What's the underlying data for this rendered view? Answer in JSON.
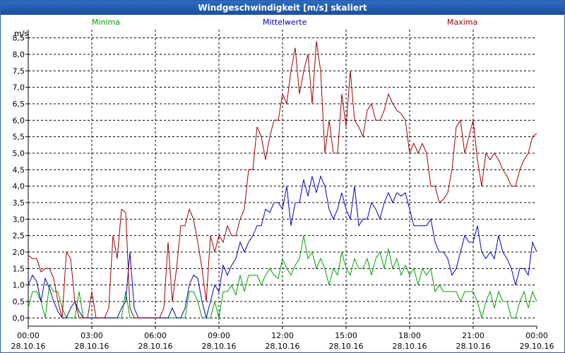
{
  "window": {
    "title": "Windgeschwindigkeit [m/s] skaliert"
  },
  "chart_data": {
    "type": "line",
    "title": "Windgeschwindigkeit [m/s] skaliert",
    "ylabel": "m/s",
    "xlabel": "",
    "ylim": [
      -0.25,
      8.75
    ],
    "xlim": [
      0,
      24
    ],
    "grid": true,
    "yticks": [
      "0,0",
      "0,5",
      "1,0",
      "1,5",
      "2,0",
      "2,5",
      "3,0",
      "3,5",
      "4,0",
      "4,5",
      "5,0",
      "5,5",
      "6,0",
      "6,5",
      "7,0",
      "7,5",
      "8,0",
      "8,5"
    ],
    "xticks": [
      {
        "time": "00:00",
        "date": "28.10.16"
      },
      {
        "time": "03:00",
        "date": "28.10.16"
      },
      {
        "time": "06:00",
        "date": "28.10.16"
      },
      {
        "time": "09:00",
        "date": "28.10.16"
      },
      {
        "time": "12:00",
        "date": "28.10.16"
      },
      {
        "time": "15:00",
        "date": "28.10.16"
      },
      {
        "time": "18:00",
        "date": "28.10.16"
      },
      {
        "time": "21:00",
        "date": "28.10.16"
      },
      {
        "time": "00:00",
        "date": "29.10.16"
      }
    ],
    "legend": [
      "Minima",
      "Mittelwerte",
      "Maxima"
    ],
    "series": [
      {
        "name": "Minima",
        "color": "#00a000",
        "x": [
          0,
          0.2,
          0.4,
          0.6,
          0.8,
          1.0,
          1.2,
          1.4,
          1.6,
          1.8,
          2.0,
          2.2,
          2.4,
          2.6,
          2.8,
          3.0,
          3.2,
          3.4,
          3.6,
          3.8,
          4.0,
          4.2,
          4.4,
          4.6,
          4.8,
          5.0,
          5.2,
          5.4,
          5.6,
          5.8,
          6.0,
          6.2,
          6.4,
          6.6,
          6.8,
          7.0,
          7.2,
          7.4,
          7.6,
          7.8,
          8.0,
          8.2,
          8.4,
          8.6,
          8.8,
          9.0,
          9.2,
          9.4,
          9.6,
          9.8,
          10.0,
          10.2,
          10.4,
          10.6,
          10.8,
          11.0,
          11.2,
          11.4,
          11.6,
          11.8,
          12.0,
          12.2,
          12.4,
          12.6,
          12.8,
          13.0,
          13.2,
          13.4,
          13.6,
          13.8,
          14.0,
          14.2,
          14.4,
          14.6,
          14.8,
          15.0,
          15.2,
          15.4,
          15.6,
          15.8,
          16.0,
          16.2,
          16.4,
          16.6,
          16.8,
          17.0,
          17.2,
          17.4,
          17.6,
          17.8,
          18.0,
          18.2,
          18.4,
          18.6,
          18.8,
          19.0,
          19.2,
          19.4,
          19.6,
          19.8,
          20.0,
          20.2,
          20.4,
          20.6,
          20.8,
          21.0,
          21.2,
          21.4,
          21.6,
          21.8,
          22.0,
          22.2,
          22.4,
          22.6,
          22.8,
          23.0,
          23.2,
          23.4,
          23.6,
          23.8,
          24.0
        ],
        "y": [
          0.3,
          0.8,
          0.8,
          0.5,
          0.0,
          1.0,
          0.8,
          0.8,
          0.3,
          0.0,
          0.0,
          0.0,
          0.8,
          0.0,
          0.0,
          0.0,
          0.0,
          0.0,
          0.0,
          0.0,
          0.0,
          0.0,
          0.0,
          0.8,
          0.0,
          0.0,
          0.0,
          0.0,
          0.0,
          0.0,
          0.0,
          0.0,
          0.0,
          0.0,
          0.0,
          0.0,
          0.0,
          0.0,
          0.8,
          0.8,
          0.5,
          0.0,
          0.0,
          0.0,
          0.5,
          0.0,
          0.8,
          0.8,
          1.0,
          0.7,
          1.3,
          0.8,
          1.3,
          1.3,
          1.3,
          1.0,
          1.3,
          1.5,
          1.3,
          1.2,
          1.8,
          1.5,
          1.3,
          1.6,
          1.8,
          2.5,
          1.8,
          2.0,
          1.5,
          1.8,
          1.5,
          1.0,
          1.5,
          1.3,
          2.0,
          1.5,
          1.3,
          1.8,
          1.5,
          1.5,
          1.8,
          1.3,
          1.8,
          2.0,
          1.5,
          2.1,
          1.5,
          1.8,
          1.3,
          1.6,
          1.3,
          1.5,
          1.0,
          1.5,
          1.3,
          1.5,
          0.8,
          1.0,
          0.8,
          0.8,
          0.8,
          0.8,
          0.5,
          0.8,
          0.8,
          0.8,
          0.5,
          0.0,
          0.5,
          0.8,
          0.3,
          0.8,
          0.5,
          0.5,
          0.0,
          0.0,
          0.5,
          0.8,
          0.3,
          0.8,
          0.5
        ]
      },
      {
        "name": "Mittelwerte",
        "color": "#0000c0",
        "x": [
          0,
          0.2,
          0.4,
          0.6,
          0.8,
          1.0,
          1.2,
          1.4,
          1.6,
          1.8,
          2.0,
          2.2,
          2.4,
          2.6,
          2.8,
          3.0,
          3.2,
          3.4,
          3.6,
          3.8,
          4.0,
          4.2,
          4.4,
          4.6,
          4.8,
          5.0,
          5.2,
          5.4,
          5.6,
          5.8,
          6.0,
          6.2,
          6.4,
          6.6,
          6.8,
          7.0,
          7.2,
          7.4,
          7.6,
          7.8,
          8.0,
          8.2,
          8.4,
          8.6,
          8.8,
          9.0,
          9.2,
          9.4,
          9.6,
          9.8,
          10.0,
          10.2,
          10.4,
          10.6,
          10.8,
          11.0,
          11.2,
          11.4,
          11.6,
          11.8,
          12.0,
          12.2,
          12.4,
          12.6,
          12.8,
          13.0,
          13.2,
          13.4,
          13.6,
          13.8,
          14.0,
          14.2,
          14.4,
          14.6,
          14.8,
          15.0,
          15.2,
          15.4,
          15.6,
          15.8,
          16.0,
          16.2,
          16.4,
          16.6,
          16.8,
          17.0,
          17.2,
          17.4,
          17.6,
          17.8,
          18.0,
          18.2,
          18.4,
          18.6,
          18.8,
          19.0,
          19.2,
          19.4,
          19.6,
          19.8,
          20.0,
          20.2,
          20.4,
          20.6,
          20.8,
          21.0,
          21.2,
          21.4,
          21.6,
          21.8,
          22.0,
          22.2,
          22.4,
          22.6,
          22.8,
          23.0,
          23.2,
          23.4,
          23.6,
          23.8,
          24.0
        ],
        "y": [
          1.0,
          1.3,
          1.1,
          0.5,
          1.2,
          0.9,
          0.5,
          0.2,
          0.0,
          0.0,
          0.3,
          0.5,
          0.2,
          0.0,
          0.0,
          0.0,
          0.0,
          0.0,
          0.0,
          0.0,
          0.0,
          0.0,
          0.3,
          0.5,
          2.0,
          0.3,
          0.0,
          0.0,
          0.0,
          0.0,
          0.0,
          0.0,
          0.0,
          0.0,
          0.3,
          0.0,
          0.0,
          0.3,
          1.0,
          1.3,
          1.2,
          0.5,
          0.0,
          0.5,
          1.0,
          0.8,
          1.6,
          1.3,
          1.6,
          1.8,
          2.3,
          2.0,
          2.3,
          2.5,
          2.8,
          2.8,
          3.3,
          3.2,
          3.5,
          3.5,
          3.3,
          4.0,
          2.8,
          3.5,
          3.5,
          4.2,
          3.7,
          4.3,
          3.8,
          4.3,
          4.0,
          3.3,
          3.0,
          3.3,
          3.8,
          3.3,
          3.0,
          4.0,
          2.8,
          3.0,
          3.0,
          3.5,
          3.3,
          3.0,
          3.5,
          3.8,
          3.5,
          3.8,
          3.7,
          3.8,
          3.3,
          2.8,
          2.8,
          2.8,
          2.8,
          3.0,
          2.3,
          2.0,
          2.0,
          1.8,
          1.3,
          1.5,
          2.0,
          2.5,
          2.3,
          2.3,
          2.8,
          2.0,
          1.8,
          2.0,
          1.8,
          2.5,
          2.0,
          1.8,
          1.5,
          1.0,
          1.5,
          1.5,
          1.3,
          2.3,
          2.0
        ]
      },
      {
        "name": "Maxima",
        "color": "#a00000",
        "x": [
          0,
          0.2,
          0.4,
          0.6,
          0.8,
          1.0,
          1.2,
          1.4,
          1.6,
          1.8,
          2.0,
          2.2,
          2.4,
          2.6,
          2.8,
          3.0,
          3.2,
          3.4,
          3.6,
          3.8,
          4.0,
          4.2,
          4.4,
          4.6,
          4.8,
          5.0,
          5.2,
          5.4,
          5.6,
          5.8,
          6.0,
          6.2,
          6.4,
          6.6,
          6.8,
          7.0,
          7.2,
          7.4,
          7.6,
          7.8,
          8.0,
          8.2,
          8.4,
          8.6,
          8.8,
          9.0,
          9.2,
          9.4,
          9.6,
          9.8,
          10.0,
          10.2,
          10.4,
          10.6,
          10.8,
          11.0,
          11.2,
          11.4,
          11.6,
          11.8,
          12.0,
          12.2,
          12.4,
          12.6,
          12.8,
          13.0,
          13.2,
          13.4,
          13.6,
          13.8,
          14.0,
          14.2,
          14.4,
          14.6,
          14.8,
          15.0,
          15.2,
          15.4,
          15.6,
          15.8,
          16.0,
          16.2,
          16.4,
          16.6,
          16.8,
          17.0,
          17.2,
          17.4,
          17.6,
          17.8,
          18.0,
          18.2,
          18.4,
          18.6,
          18.8,
          19.0,
          19.2,
          19.4,
          19.6,
          19.8,
          20.0,
          20.2,
          20.4,
          20.6,
          20.8,
          21.0,
          21.2,
          21.4,
          21.6,
          21.8,
          22.0,
          22.2,
          22.4,
          22.6,
          22.8,
          23.0,
          23.2,
          23.4,
          23.6,
          23.8,
          24.0
        ],
        "y": [
          1.9,
          1.8,
          1.8,
          1.4,
          1.5,
          1.5,
          1.2,
          0.5,
          0.0,
          2.0,
          1.8,
          0.5,
          0.0,
          0.0,
          0.0,
          0.8,
          0.0,
          0.0,
          0.0,
          0.3,
          2.5,
          1.8,
          3.3,
          3.2,
          0.3,
          0.0,
          0.0,
          0.0,
          0.0,
          0.0,
          0.0,
          0.0,
          0.3,
          2.3,
          0.5,
          1.5,
          2.8,
          2.8,
          3.3,
          3.0,
          2.3,
          1.5,
          0.5,
          2.5,
          2.0,
          2.5,
          2.3,
          2.8,
          2.5,
          2.5,
          3.0,
          3.3,
          4.5,
          4.5,
          5.8,
          5.5,
          4.8,
          5.5,
          6.0,
          6.0,
          6.8,
          6.5,
          7.5,
          8.2,
          6.8,
          7.5,
          8.0,
          6.5,
          8.4,
          7.5,
          5.0,
          6.0,
          5.0,
          5.0,
          6.8,
          5.8,
          7.5,
          6.0,
          5.8,
          5.5,
          6.3,
          6.5,
          6.0,
          6.0,
          6.3,
          6.8,
          6.5,
          6.3,
          6.2,
          6.0,
          5.0,
          5.3,
          5.0,
          5.3,
          5.0,
          4.0,
          4.0,
          3.5,
          3.6,
          3.8,
          4.5,
          5.8,
          6.0,
          5.0,
          5.5,
          6.0,
          4.8,
          4.0,
          5.0,
          4.8,
          5.0,
          4.8,
          4.5,
          4.3,
          4.0,
          4.0,
          4.5,
          4.8,
          5.0,
          5.5,
          5.6
        ]
      }
    ]
  }
}
